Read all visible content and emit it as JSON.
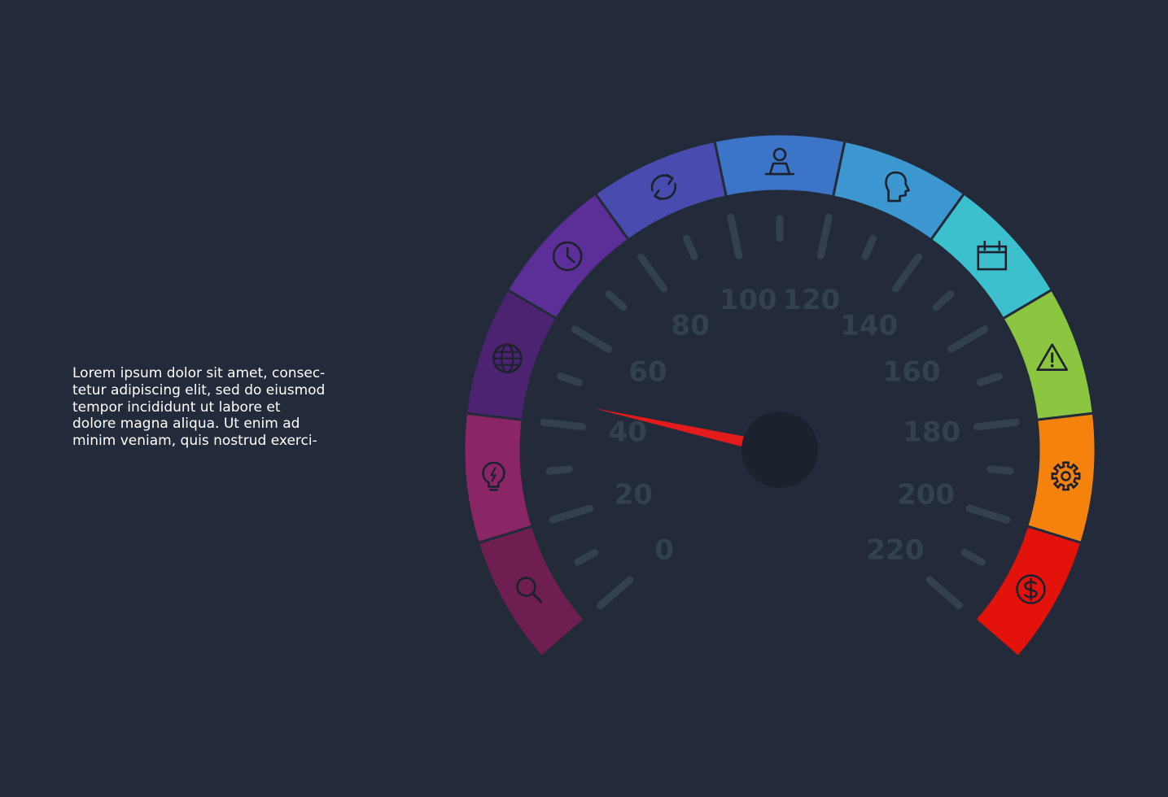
{
  "description": {
    "lines": [
      "Lorem ipsum dolor sit amet, consec-",
      "tetur adipiscing elit, sed do eiusmod",
      "tempor incididunt ut labore et",
      "dolore magna aliqua. Ut enim ad",
      "minim veniam, quis nostrud exerci-"
    ]
  },
  "gauge": {
    "scale_labels": [
      "0",
      "20",
      "40",
      "60",
      "80",
      "100",
      "120",
      "140",
      "160",
      "180",
      "200",
      "220"
    ],
    "min": 0,
    "max": 220,
    "needle_value": 45,
    "needle_color": "#e31b1b",
    "hub_color": "#1c222d",
    "tick_color": "#343f50",
    "segments": [
      {
        "icon": "search-icon",
        "color": "#6e1e50"
      },
      {
        "icon": "lightbulb-icon",
        "color": "#8a2566"
      },
      {
        "icon": "globe-icon",
        "color": "#4b2370"
      },
      {
        "icon": "clock-icon",
        "color": "#5c2e98"
      },
      {
        "icon": "refresh-icon",
        "color": "#4a4baf"
      },
      {
        "icon": "user-icon",
        "color": "#3c74c8"
      },
      {
        "icon": "head-profile-icon",
        "color": "#3c96cf"
      },
      {
        "icon": "calendar-icon",
        "color": "#3dc0ce"
      },
      {
        "icon": "warning-icon",
        "color": "#8cc540"
      },
      {
        "icon": "gear-icon",
        "color": "#f5820c"
      },
      {
        "icon": "dollar-icon",
        "color": "#e3130c"
      }
    ]
  }
}
